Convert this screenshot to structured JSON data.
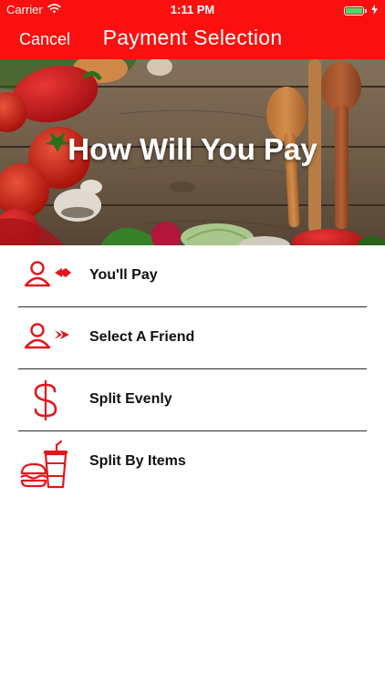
{
  "status_bar": {
    "carrier": "Carrier",
    "time": "1:11 PM",
    "battery_level": 1.0,
    "icons": [
      "wifi-icon",
      "battery-icon",
      "charging-icon"
    ]
  },
  "nav": {
    "cancel_label": "Cancel",
    "title": "Payment Selection"
  },
  "hero": {
    "title": "How Will You Pay"
  },
  "options": [
    {
      "label": "You'll Pay",
      "icon": "person-arrow-left-icon"
    },
    {
      "label": "Select A Friend",
      "icon": "person-arrow-right-icon"
    },
    {
      "label": "Split Evenly",
      "icon": "dollar-icon"
    },
    {
      "label": "Split By Items",
      "icon": "burger-drink-icon"
    }
  ],
  "colors": {
    "accent": "#fb0f0f",
    "icon": "#e3161c",
    "text": "#111111",
    "divider": "#2b2b2b",
    "battery": "#4cd964"
  }
}
